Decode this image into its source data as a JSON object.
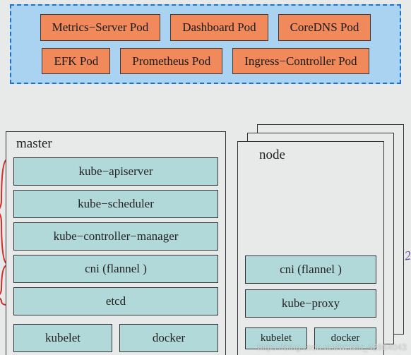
{
  "addons": {
    "pods": [
      "Metrics−Server Pod",
      "Dashboard Pod",
      "CoreDNS Pod",
      "EFK Pod",
      "Prometheus Pod",
      "Ingress−Controller Pod"
    ]
  },
  "master": {
    "title": "master",
    "services": [
      "kube−apiserver",
      "kube−scheduler",
      "kube−controller−manager",
      "cni (flannel )",
      "etcd"
    ],
    "bottom": [
      "kubelet",
      "docker"
    ]
  },
  "node": {
    "title": "node",
    "services": [
      "cni (flannel )",
      "kube−proxy"
    ],
    "bottom": [
      "kubelet",
      "docker"
    ]
  },
  "watermark": "https://blog.csdn.net/weixin_42864043",
  "colors": {
    "addons_bg": "#aad3f2",
    "addons_border": "#1b74c7",
    "pod_bg": "#f08a5a",
    "service_bg": "#b2d9d9"
  }
}
